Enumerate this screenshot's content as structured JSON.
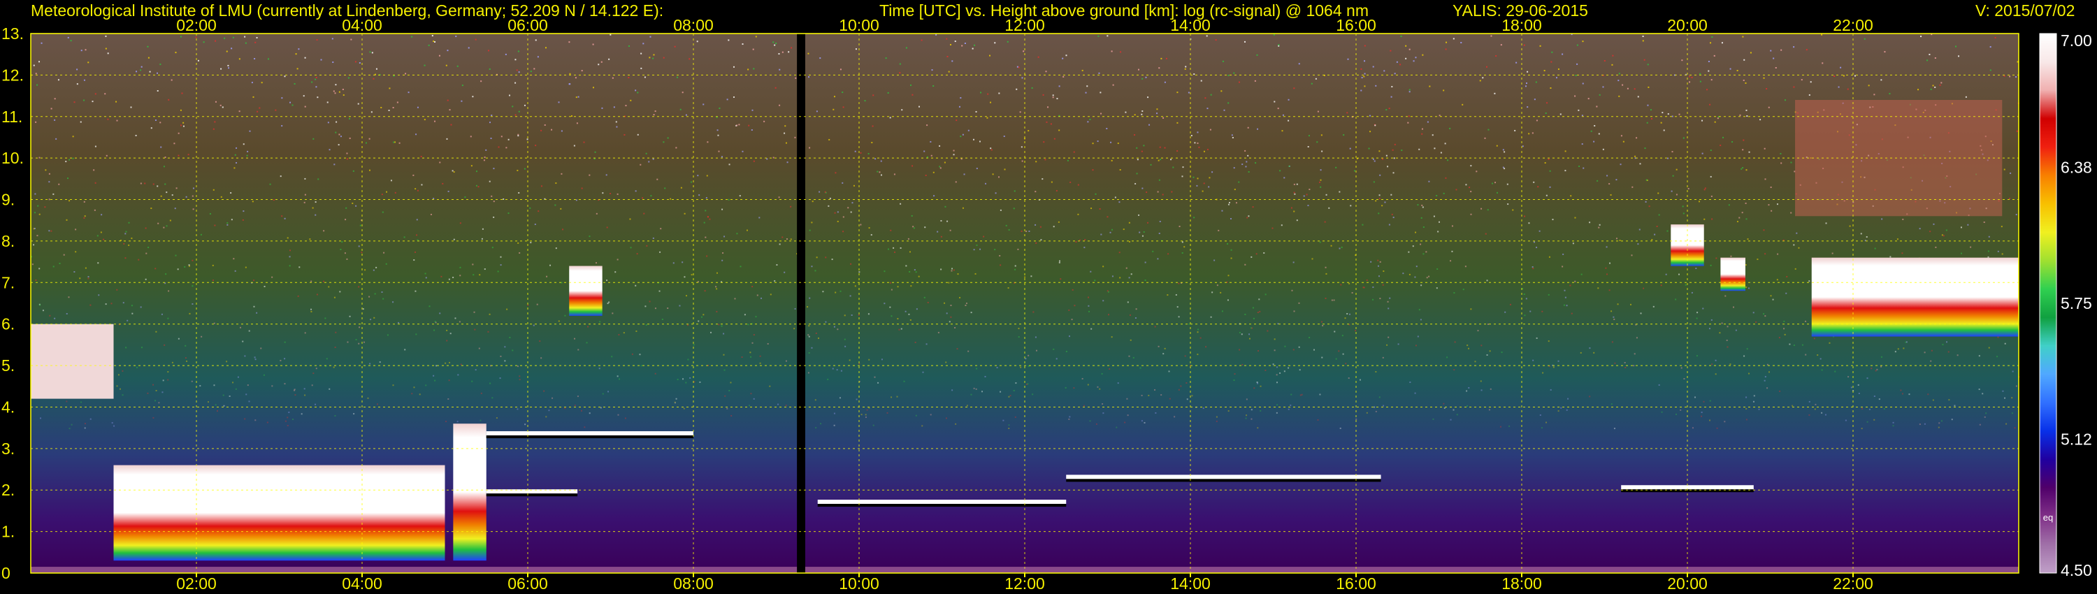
{
  "header": {
    "institute": "Meteorological Institute of LMU (currently at Lindenberg, Germany; 52.209 N / 14.122 E):",
    "axes_title": "Time [UTC] vs. Height above ground [km]: log (rc-signal) @ 1064 nm",
    "instrument": "YALIS: 29-06-2015",
    "version": "V: 2015/07/02"
  },
  "chart_data": {
    "type": "heatmap",
    "x_unit": "hours UTC",
    "xlim": [
      0,
      24
    ],
    "x_ticks": [
      2,
      4,
      6,
      8,
      10,
      12,
      14,
      16,
      18,
      20,
      22
    ],
    "x_tick_labels": [
      "02:00",
      "04:00",
      "06:00",
      "08:00",
      "10:00",
      "12:00",
      "14:00",
      "16:00",
      "18:00",
      "20:00",
      "22:00"
    ],
    "ylim": [
      0,
      13
    ],
    "y_ticks": [
      0,
      1,
      2,
      3,
      4,
      5,
      6,
      7,
      8,
      9,
      10,
      11,
      12,
      13
    ],
    "y_tick_labels": [
      "0",
      "1.",
      "2.",
      "3.",
      "4.",
      "5.",
      "6.",
      "7.",
      "8.",
      "9.",
      "10.",
      "11.",
      "12.",
      "13."
    ],
    "grid": true,
    "colorbar": {
      "min": 4.5,
      "max": 7.0,
      "tick_values": [
        4.5,
        5.12,
        5.75,
        6.38,
        7.0
      ],
      "tick_labels": [
        "4.50",
        "5.12",
        "5.75",
        "6.38",
        "7.00"
      ],
      "note": "eq",
      "colors": [
        "#c0a0c8",
        "#a070a8",
        "#803088",
        "#50006a",
        "#2000a0",
        "#0830e8",
        "#3070ff",
        "#50a8ff",
        "#40d0c8",
        "#10a040",
        "#30d050",
        "#a0e030",
        "#f0f020",
        "#f8c000",
        "#f88000",
        "#f02010",
        "#d00000",
        "#f0b0b0",
        "#f8e8e8",
        "#ffffff"
      ]
    },
    "data_gap": {
      "start": 9.25,
      "end": 9.35
    },
    "layers": [
      {
        "kind": "boundary_layer",
        "start": 0.0,
        "end": 24.0,
        "top": 1.9
      },
      {
        "kind": "aerosol_layer",
        "start": 0.0,
        "end": 1.0,
        "bottom": 4.2,
        "top": 6.0
      },
      {
        "kind": "cloud",
        "start": 1.0,
        "end": 5.0,
        "bottom": 0.3,
        "top": 2.6
      },
      {
        "kind": "cloud",
        "start": 5.1,
        "end": 5.5,
        "bottom": 0.3,
        "top": 3.6
      },
      {
        "kind": "cloud_base",
        "start": 5.5,
        "end": 8.0,
        "height": 3.35
      },
      {
        "kind": "cloud_base",
        "start": 5.5,
        "end": 6.6,
        "height": 1.95
      },
      {
        "kind": "cloud",
        "start": 6.5,
        "end": 6.9,
        "bottom": 6.2,
        "top": 7.4
      },
      {
        "kind": "cloud_base",
        "start": 9.5,
        "end": 12.5,
        "height": 1.7
      },
      {
        "kind": "cloud_base",
        "start": 12.5,
        "end": 16.3,
        "height": 2.3
      },
      {
        "kind": "cloud_base",
        "start": 19.2,
        "end": 20.8,
        "height": 2.05
      },
      {
        "kind": "cloud",
        "start": 19.8,
        "end": 20.2,
        "bottom": 7.4,
        "top": 8.4
      },
      {
        "kind": "cloud",
        "start": 20.4,
        "end": 20.7,
        "bottom": 6.8,
        "top": 7.6
      },
      {
        "kind": "cloud",
        "start": 21.5,
        "end": 24.0,
        "bottom": 5.7,
        "top": 7.6
      },
      {
        "kind": "cirrus",
        "start": 21.3,
        "end": 23.8,
        "bottom": 8.6,
        "top": 11.4
      }
    ]
  }
}
